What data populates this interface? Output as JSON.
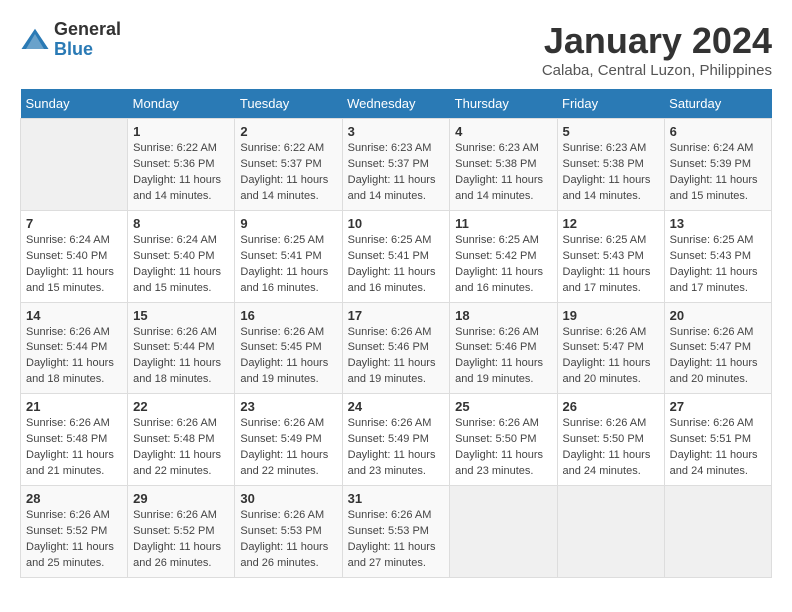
{
  "logo": {
    "line1": "General",
    "line2": "Blue"
  },
  "title": "January 2024",
  "subtitle": "Calaba, Central Luzon, Philippines",
  "days_of_week": [
    "Sunday",
    "Monday",
    "Tuesday",
    "Wednesday",
    "Thursday",
    "Friday",
    "Saturday"
  ],
  "weeks": [
    [
      {
        "num": "",
        "info": ""
      },
      {
        "num": "1",
        "info": "Sunrise: 6:22 AM\nSunset: 5:36 PM\nDaylight: 11 hours\nand 14 minutes."
      },
      {
        "num": "2",
        "info": "Sunrise: 6:22 AM\nSunset: 5:37 PM\nDaylight: 11 hours\nand 14 minutes."
      },
      {
        "num": "3",
        "info": "Sunrise: 6:23 AM\nSunset: 5:37 PM\nDaylight: 11 hours\nand 14 minutes."
      },
      {
        "num": "4",
        "info": "Sunrise: 6:23 AM\nSunset: 5:38 PM\nDaylight: 11 hours\nand 14 minutes."
      },
      {
        "num": "5",
        "info": "Sunrise: 6:23 AM\nSunset: 5:38 PM\nDaylight: 11 hours\nand 14 minutes."
      },
      {
        "num": "6",
        "info": "Sunrise: 6:24 AM\nSunset: 5:39 PM\nDaylight: 11 hours\nand 15 minutes."
      }
    ],
    [
      {
        "num": "7",
        "info": "Sunrise: 6:24 AM\nSunset: 5:40 PM\nDaylight: 11 hours\nand 15 minutes."
      },
      {
        "num": "8",
        "info": "Sunrise: 6:24 AM\nSunset: 5:40 PM\nDaylight: 11 hours\nand 15 minutes."
      },
      {
        "num": "9",
        "info": "Sunrise: 6:25 AM\nSunset: 5:41 PM\nDaylight: 11 hours\nand 16 minutes."
      },
      {
        "num": "10",
        "info": "Sunrise: 6:25 AM\nSunset: 5:41 PM\nDaylight: 11 hours\nand 16 minutes."
      },
      {
        "num": "11",
        "info": "Sunrise: 6:25 AM\nSunset: 5:42 PM\nDaylight: 11 hours\nand 16 minutes."
      },
      {
        "num": "12",
        "info": "Sunrise: 6:25 AM\nSunset: 5:43 PM\nDaylight: 11 hours\nand 17 minutes."
      },
      {
        "num": "13",
        "info": "Sunrise: 6:25 AM\nSunset: 5:43 PM\nDaylight: 11 hours\nand 17 minutes."
      }
    ],
    [
      {
        "num": "14",
        "info": "Sunrise: 6:26 AM\nSunset: 5:44 PM\nDaylight: 11 hours\nand 18 minutes."
      },
      {
        "num": "15",
        "info": "Sunrise: 6:26 AM\nSunset: 5:44 PM\nDaylight: 11 hours\nand 18 minutes."
      },
      {
        "num": "16",
        "info": "Sunrise: 6:26 AM\nSunset: 5:45 PM\nDaylight: 11 hours\nand 19 minutes."
      },
      {
        "num": "17",
        "info": "Sunrise: 6:26 AM\nSunset: 5:46 PM\nDaylight: 11 hours\nand 19 minutes."
      },
      {
        "num": "18",
        "info": "Sunrise: 6:26 AM\nSunset: 5:46 PM\nDaylight: 11 hours\nand 19 minutes."
      },
      {
        "num": "19",
        "info": "Sunrise: 6:26 AM\nSunset: 5:47 PM\nDaylight: 11 hours\nand 20 minutes."
      },
      {
        "num": "20",
        "info": "Sunrise: 6:26 AM\nSunset: 5:47 PM\nDaylight: 11 hours\nand 20 minutes."
      }
    ],
    [
      {
        "num": "21",
        "info": "Sunrise: 6:26 AM\nSunset: 5:48 PM\nDaylight: 11 hours\nand 21 minutes."
      },
      {
        "num": "22",
        "info": "Sunrise: 6:26 AM\nSunset: 5:48 PM\nDaylight: 11 hours\nand 22 minutes."
      },
      {
        "num": "23",
        "info": "Sunrise: 6:26 AM\nSunset: 5:49 PM\nDaylight: 11 hours\nand 22 minutes."
      },
      {
        "num": "24",
        "info": "Sunrise: 6:26 AM\nSunset: 5:49 PM\nDaylight: 11 hours\nand 23 minutes."
      },
      {
        "num": "25",
        "info": "Sunrise: 6:26 AM\nSunset: 5:50 PM\nDaylight: 11 hours\nand 23 minutes."
      },
      {
        "num": "26",
        "info": "Sunrise: 6:26 AM\nSunset: 5:50 PM\nDaylight: 11 hours\nand 24 minutes."
      },
      {
        "num": "27",
        "info": "Sunrise: 6:26 AM\nSunset: 5:51 PM\nDaylight: 11 hours\nand 24 minutes."
      }
    ],
    [
      {
        "num": "28",
        "info": "Sunrise: 6:26 AM\nSunset: 5:52 PM\nDaylight: 11 hours\nand 25 minutes."
      },
      {
        "num": "29",
        "info": "Sunrise: 6:26 AM\nSunset: 5:52 PM\nDaylight: 11 hours\nand 26 minutes."
      },
      {
        "num": "30",
        "info": "Sunrise: 6:26 AM\nSunset: 5:53 PM\nDaylight: 11 hours\nand 26 minutes."
      },
      {
        "num": "31",
        "info": "Sunrise: 6:26 AM\nSunset: 5:53 PM\nDaylight: 11 hours\nand 27 minutes."
      },
      {
        "num": "",
        "info": ""
      },
      {
        "num": "",
        "info": ""
      },
      {
        "num": "",
        "info": ""
      }
    ]
  ]
}
